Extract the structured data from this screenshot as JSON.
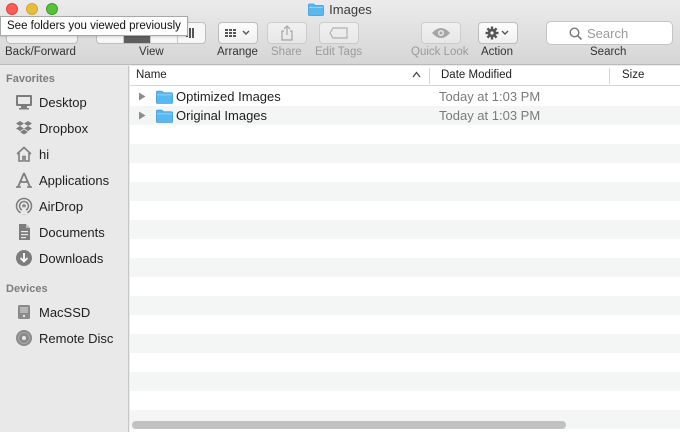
{
  "window": {
    "title": "Images"
  },
  "tooltip": {
    "text": "See folders you viewed previously"
  },
  "toolbar": {
    "back_forward_label": "Back/Forward",
    "view_label": "View",
    "arrange_label": "Arrange",
    "share_label": "Share",
    "edit_tags_label": "Edit Tags",
    "quick_look_label": "Quick Look",
    "action_label": "Action",
    "search_label": "Search",
    "search_placeholder": "Search"
  },
  "sidebar": {
    "favorites_heading": "Favorites",
    "favorites": [
      {
        "label": "Desktop",
        "icon": "desktop-icon"
      },
      {
        "label": "Dropbox",
        "icon": "dropbox-icon"
      },
      {
        "label": "hi",
        "icon": "home-icon"
      },
      {
        "label": "Applications",
        "icon": "applications-icon"
      },
      {
        "label": "AirDrop",
        "icon": "airdrop-icon"
      },
      {
        "label": "Documents",
        "icon": "documents-icon"
      },
      {
        "label": "Downloads",
        "icon": "downloads-icon"
      }
    ],
    "devices_heading": "Devices",
    "devices": [
      {
        "label": "MacSSD",
        "icon": "disk-icon"
      },
      {
        "label": "Remote Disc",
        "icon": "remote-disc-icon"
      }
    ]
  },
  "list": {
    "columns": {
      "name": "Name",
      "date": "Date Modified",
      "size": "Size"
    },
    "rows": [
      {
        "name": "Optimized Images",
        "date": "Today at 1:03 PM"
      },
      {
        "name": "Original Images",
        "date": "Today at 1:03 PM"
      }
    ]
  },
  "colors": {
    "folder_blue": "#5ab8f0",
    "close": "#fc5b57",
    "minimize": "#e5bf3c",
    "maximize": "#57c038"
  }
}
